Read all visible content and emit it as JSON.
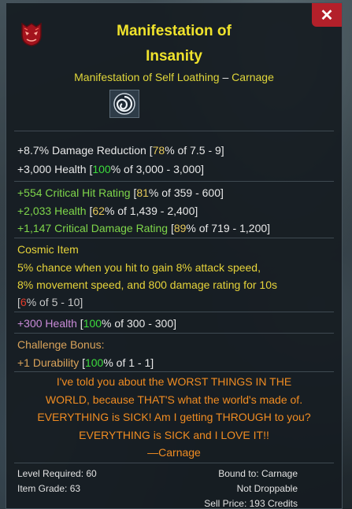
{
  "item": {
    "name_line1": "Manifestation of",
    "name_line2": "Insanity",
    "set_name": "Manifestation of Self Loathing",
    "set_sep": " – ",
    "set_owner": "Carnage",
    "rarity_icon": "red-demon-icon",
    "set_icon": "spiral-icon"
  },
  "stats": {
    "damage_reduction": {
      "label": "+8.7% Damage Reduction",
      "pct": "78",
      "range": "% of 7.5 - 9]"
    },
    "health": {
      "label": "+3,000 Health",
      "pct": "100",
      "range": "% of 3,000 - 3,000]"
    },
    "crit_hit": {
      "label": "+554 Critical Hit Rating",
      "pct": "81",
      "range": "% of 359 - 600]"
    },
    "health2": {
      "label": "+2,033 Health",
      "pct": "62",
      "range": "% of 1,439 - 2,400]"
    },
    "crit_dmg": {
      "label": "+1,147 Critical Damage Rating",
      "pct": "89",
      "range": "% of 719 - 1,200]"
    }
  },
  "cosmic": {
    "header": "Cosmic Item",
    "line1": "5% chance when you hit to gain 8% attack speed,",
    "line2": "8% movement speed, and 800 damage rating for 10s",
    "pct": "6",
    "range": "% of 5 - 10]"
  },
  "rune": {
    "label": "+300 Health",
    "pct": "100",
    "range": "% of 300 - 300]"
  },
  "challenge": {
    "header": "Challenge Bonus:",
    "label": "+1 Durability",
    "pct": "100",
    "range": "% of 1 - 1]"
  },
  "quote": {
    "l1": "I've told you about the WORST THINGS IN THE",
    "l2": "WORLD, because THAT'S what the world's made of.",
    "l3": "EVERYTHING is SICK! Am I getting THROUGH to you?",
    "l4": "EVERYTHING is SICK and I LOVE IT!!",
    "l5": "—Carnage"
  },
  "footer": {
    "level_required": "Level Required: 60",
    "item_grade": "Item Grade: 63",
    "bound_to": "Bound to: Carnage",
    "not_droppable": "Not Droppable",
    "sell_price": "Sell Price: 193 Credits"
  },
  "close_label": "✕",
  "colors": {
    "title": "#f0e32c",
    "accent_close": "#b3202a",
    "green": "#7fd64a",
    "quote": "#f08c22"
  }
}
